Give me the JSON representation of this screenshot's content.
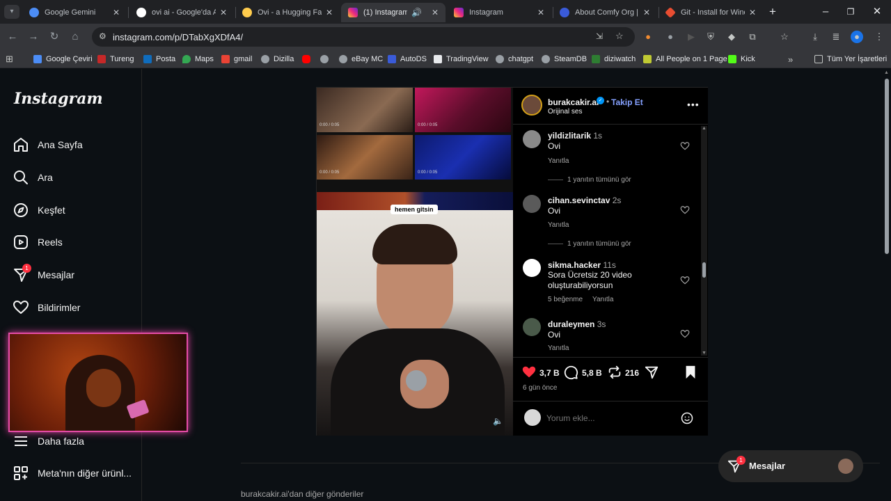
{
  "browser": {
    "tabs": [
      {
        "title": "Google Gemini",
        "color": "#4c8df6",
        "active": false
      },
      {
        "title": "ovi ai - Google'da Ar",
        "color": "#ffffff",
        "active": false
      },
      {
        "title": "Ovi - a Hugging Face",
        "color": "#ffcc4d",
        "active": false
      },
      {
        "title": "(1) Instagram",
        "color": "#e1306c",
        "active": true
      },
      {
        "title": "Instagram",
        "color": "#e1306c",
        "active": false
      },
      {
        "title": "About Comfy Org | P",
        "color": "#3a5bd9",
        "active": false
      },
      {
        "title": "Git - Install for Windo",
        "color": "#e84d31",
        "active": false
      }
    ],
    "url": "instagram.com/p/DTabXgXDfA4/",
    "bookmarks": [
      {
        "label": "Google Çeviri",
        "color": "#4c8df6"
      },
      {
        "label": "Tureng",
        "color": "#c62828"
      },
      {
        "label": "Posta",
        "color": "#0f6cbd"
      },
      {
        "label": "Maps",
        "color": "#34a853"
      },
      {
        "label": "gmail",
        "color": "#ea4335"
      },
      {
        "label": "Dizilla",
        "color": "#9aa0a6"
      },
      {
        "label": "",
        "color": "#ff0000"
      },
      {
        "label": "",
        "color": "#9aa0a6"
      },
      {
        "label": "eBay MC",
        "color": "#9aa0a6"
      },
      {
        "label": "AutoDS",
        "color": "#3a5bd9"
      },
      {
        "label": "TradingView",
        "color": "#e8eaed"
      },
      {
        "label": "chatgpt",
        "color": "#9aa0a6"
      },
      {
        "label": "SteamDB",
        "color": "#9aa0a6"
      },
      {
        "label": "diziwatch",
        "color": "#2e7d32"
      },
      {
        "label": "All People on 1 Page",
        "color": "#c0ca33"
      },
      {
        "label": "Kick",
        "color": "#53fc18"
      }
    ],
    "all_bookmarks_label": "Tüm Yer İşaretleri"
  },
  "sidebar": {
    "logo": "Instagram",
    "items": [
      {
        "label": "Ana Sayfa",
        "icon": "home-icon"
      },
      {
        "label": "Ara",
        "icon": "search-icon"
      },
      {
        "label": "Keşfet",
        "icon": "explore-icon"
      },
      {
        "label": "Reels",
        "icon": "reels-icon"
      },
      {
        "label": "Mesajlar",
        "icon": "messages-icon",
        "badge": "1"
      },
      {
        "label": "Bildirimler",
        "icon": "heart-icon"
      },
      {
        "label": "Daha fazla",
        "icon": "menu-icon"
      },
      {
        "label": "Meta'nın diğer ürünl...",
        "icon": "apps-icon"
      }
    ]
  },
  "post": {
    "author": "burakcakir.ai",
    "follow_label": "Takip Et",
    "audio": "Orijinal ses",
    "caption_sticker": "hemen gitsin",
    "thumb_times": [
      "0:00 / 0:05",
      "0:00 / 0:05",
      "0:00 / 0:05",
      "0:00 / 0:05"
    ],
    "comments": [
      {
        "user": "yildizlitarik",
        "time": "1s",
        "text": "Ovi",
        "likes": "",
        "reply": "Yanıtla",
        "view_replies": "1 yanıtın tümünü gör"
      },
      {
        "user": "cihan.sevinctav",
        "time": "2s",
        "text": "Ovi",
        "likes": "",
        "reply": "Yanıtla",
        "view_replies": "1 yanıtın tümünü gör"
      },
      {
        "user": "sikma.hacker",
        "time": "11s",
        "text": "Sora Ücretsiz 20 video oluşturabiliyorsun",
        "likes": "5 beğenme",
        "reply": "Yanıtla",
        "view_replies": ""
      },
      {
        "user": "duraleymen",
        "time": "3s",
        "text": "Ovi",
        "likes": "",
        "reply": "Yanıtla",
        "view_replies": ""
      }
    ],
    "like_count": "3,7 B",
    "comment_count": "5,8 B",
    "repost_count": "216",
    "posted_ago": "6 gün önce",
    "comment_placeholder": "Yorum ekle..."
  },
  "more_posts_label": "burakcakir.ai'dan diğer gönderiler",
  "dm_float": {
    "label": "Mesajlar",
    "badge": "1"
  }
}
